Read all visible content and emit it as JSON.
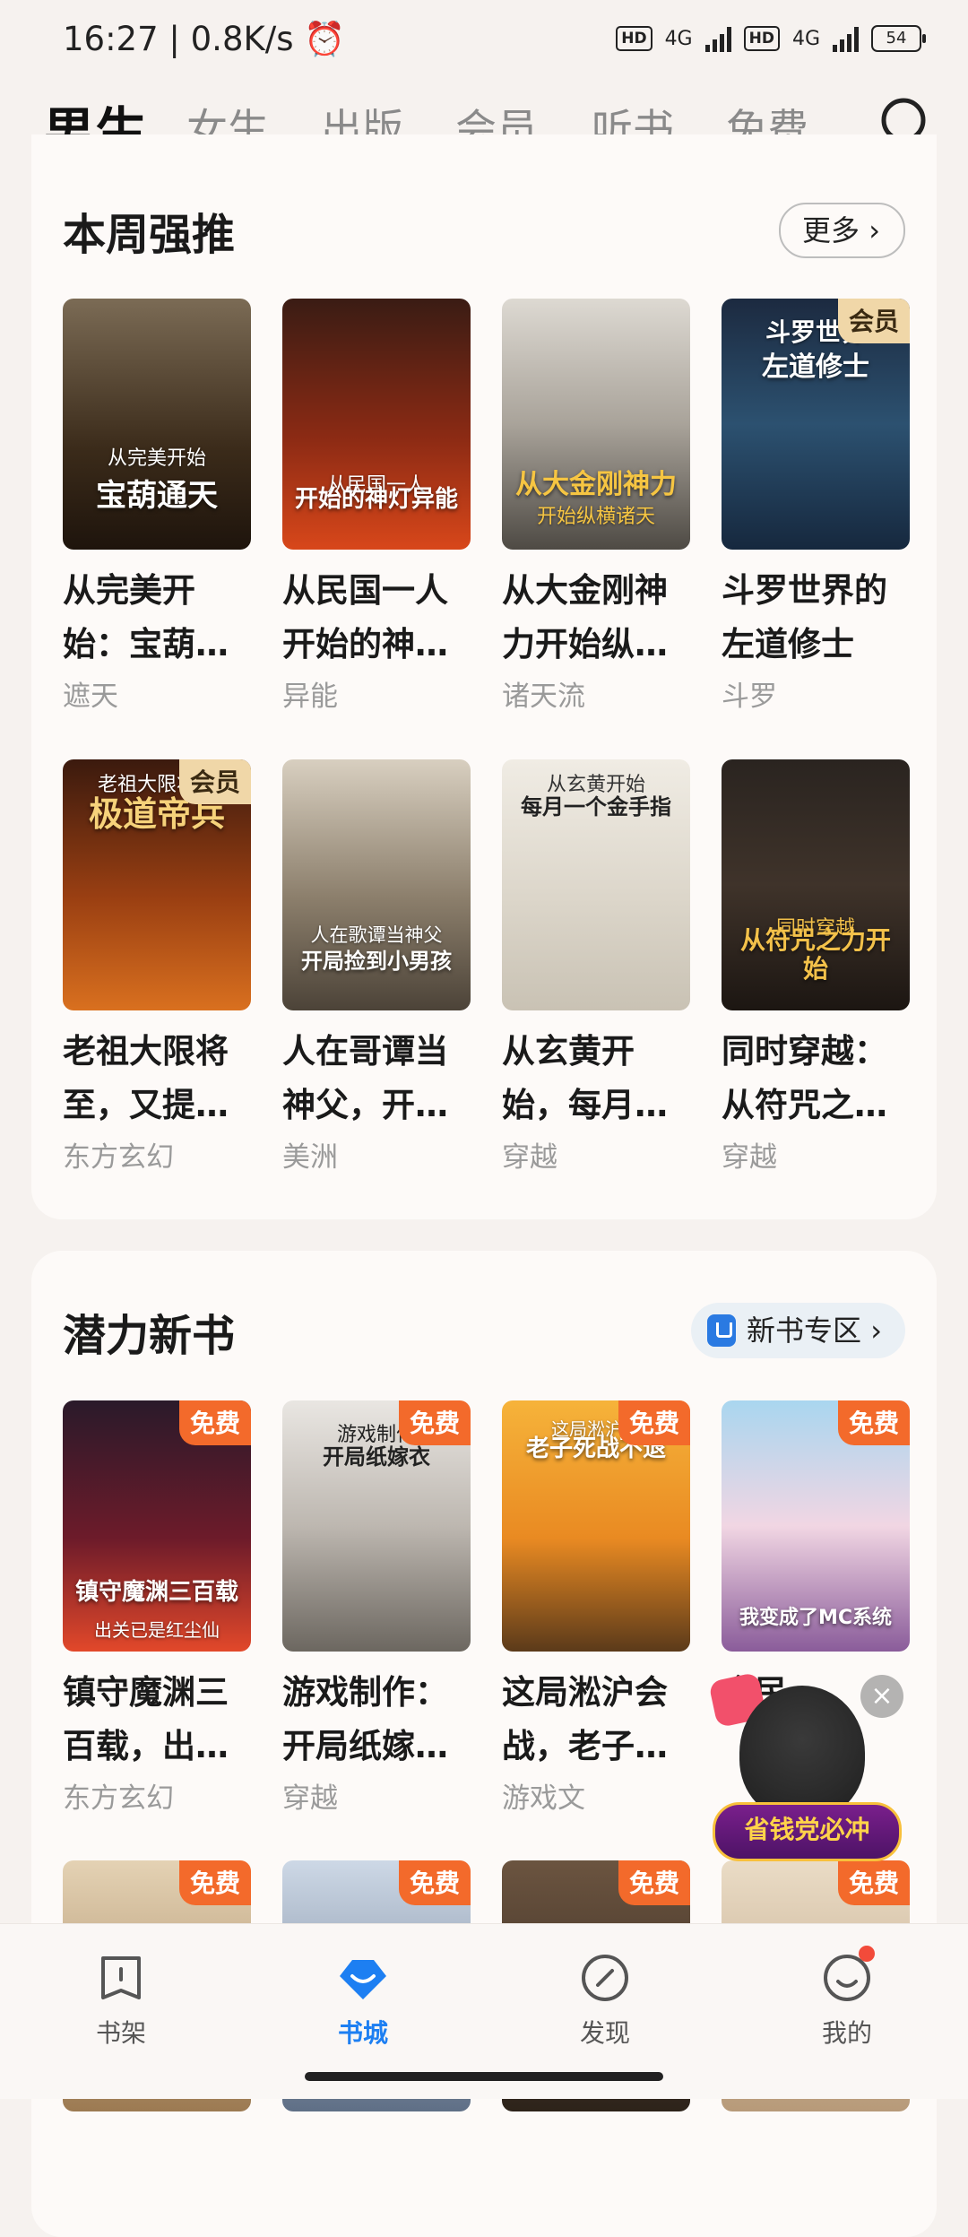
{
  "status_bar": {
    "time": "16:27",
    "speed": "0.8K/s",
    "hd": "HD",
    "net": "4G",
    "battery": "54"
  },
  "top_tabs": [
    "男生",
    "女生",
    "出版",
    "会员",
    "听书",
    "免费"
  ],
  "weekly": {
    "title": "本周强推",
    "more": "更多 ›",
    "books": [
      {
        "title": "从完美开始：宝葫…",
        "tag": "遮天",
        "cover_text": "宝葫通天",
        "cover_sub": "从完美开始",
        "badge": ""
      },
      {
        "title": "从民国一人开始的神…",
        "tag": "异能",
        "cover_text": "开始的神灯异能",
        "cover_sub": "从民国一人",
        "badge": ""
      },
      {
        "title": "从大金刚神力开始纵…",
        "tag": "诸天流",
        "cover_text": "从大金刚神力",
        "cover_sub": "开始纵横诸天",
        "badge": ""
      },
      {
        "title": "斗罗世界的左道修士",
        "tag": "斗罗",
        "cover_text": "左道修士",
        "cover_sub": "斗罗世界",
        "badge": "会员"
      },
      {
        "title": "老祖大限将至，又提…",
        "tag": "东方玄幻",
        "cover_text": "极道帝兵",
        "cover_sub": "老祖大限将至",
        "badge": "会员"
      },
      {
        "title": "人在哥谭当神父，开…",
        "tag": "美洲",
        "cover_text": "开局捡到小男孩",
        "cover_sub": "人在歌谭当神父",
        "badge": ""
      },
      {
        "title": "从玄黄开始，每月…",
        "tag": "穿越",
        "cover_text": "每月一个金手指",
        "cover_sub": "从玄黄开始",
        "badge": ""
      },
      {
        "title": "同时穿越：从符咒之…",
        "tag": "穿越",
        "cover_text": "从符咒之力开始",
        "cover_sub": "同时穿越",
        "badge": ""
      }
    ]
  },
  "potential": {
    "title": "潜力新书",
    "more": "新书专区 ›",
    "books": [
      {
        "title": "镇守魔渊三百载，出…",
        "tag": "东方玄幻",
        "cover_text": "镇守魔渊三百载",
        "cover_sub": "出关已是红尘仙",
        "badge": "免费"
      },
      {
        "title": "游戏制作：开局纸嫁…",
        "tag": "穿越",
        "cover_text": "开局纸嫁衣",
        "cover_sub": "游戏制作",
        "badge": "免费"
      },
      {
        "title": "这局淞沪会战，老子…",
        "tag": "游戏文",
        "cover_text": "老子死战不退",
        "cover_sub": "这局淞沪会",
        "badge": "免费"
      },
      {
        "title": "全民…",
        "tag": "",
        "cover_text": "我变成了MC系统",
        "cover_sub": "",
        "badge": "免费"
      },
      {
        "title": "",
        "tag": "",
        "cover_text": "",
        "cover_sub": "",
        "badge": "免费"
      },
      {
        "title": "",
        "tag": "",
        "cover_text": "",
        "cover_sub": "",
        "badge": "免费"
      },
      {
        "title": "",
        "tag": "",
        "cover_text": "",
        "cover_sub": "",
        "badge": "免费"
      },
      {
        "title": "",
        "tag": "",
        "cover_text": "",
        "cover_sub": "",
        "badge": "免费"
      }
    ]
  },
  "promo": {
    "text": "省钱党必冲",
    "close": "×"
  },
  "bottom_nav": [
    "书架",
    "书城",
    "发现",
    "我的"
  ],
  "colors": {
    "accent": "#1d7ff2",
    "free_badge": "#f36a2b",
    "vip_badge": "#f0d7a8"
  }
}
